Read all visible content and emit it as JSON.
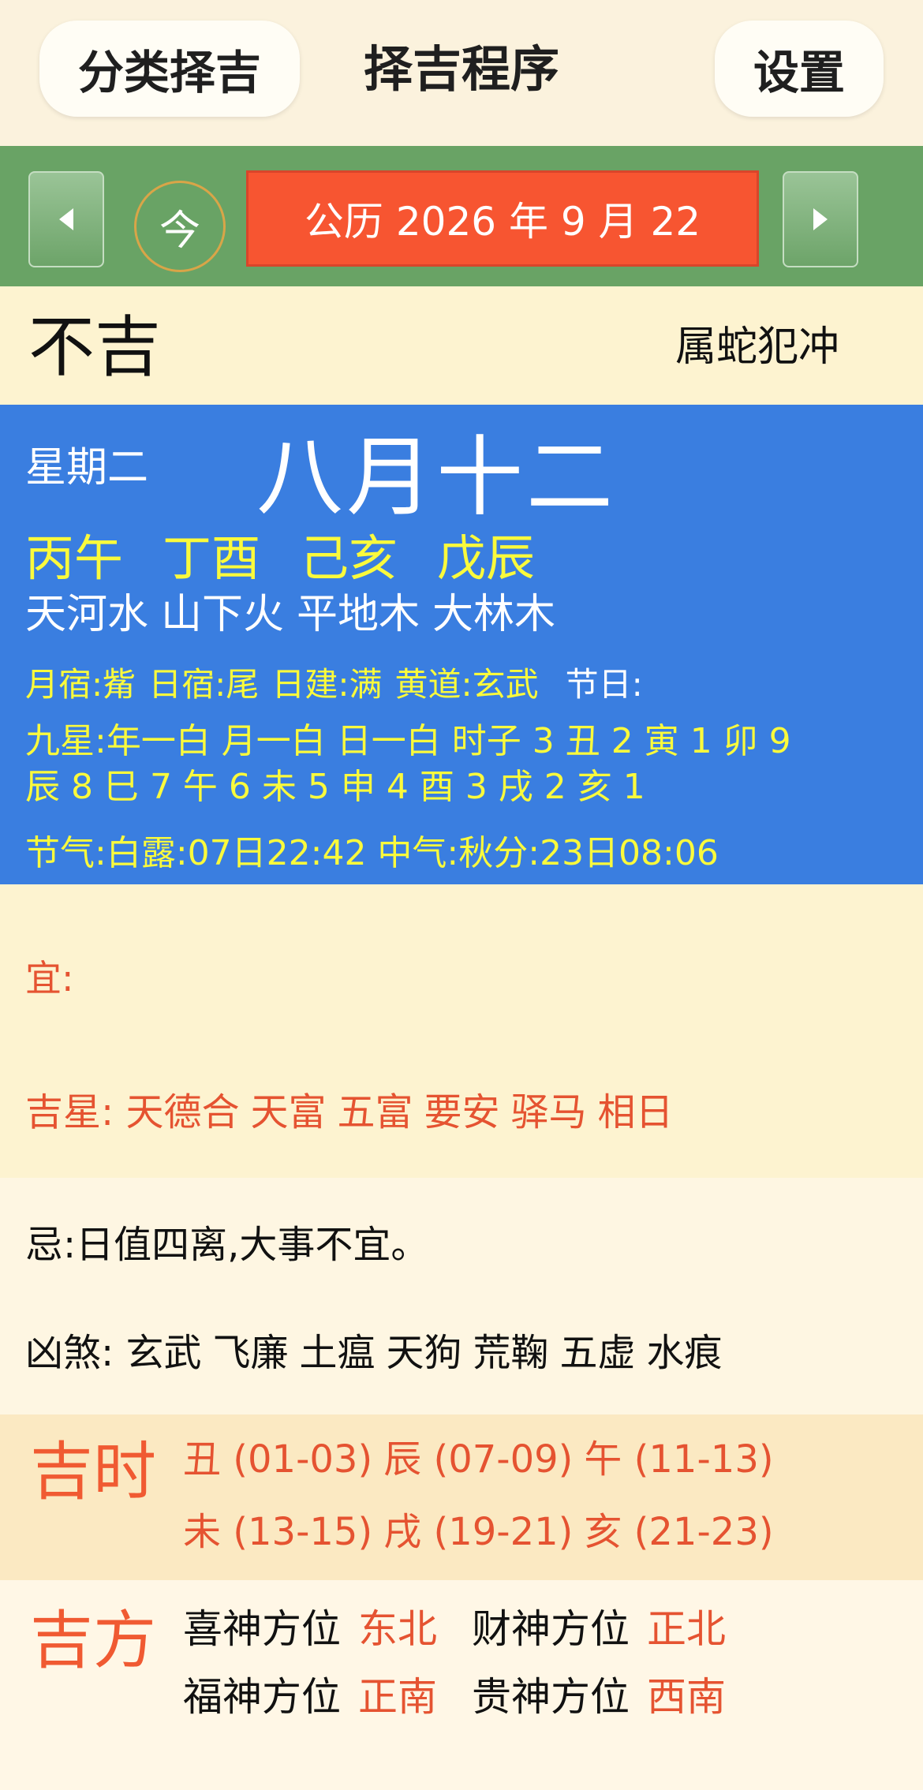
{
  "header": {
    "category_label": "分类择吉",
    "title": "择吉程序",
    "settings_label": "设置"
  },
  "date_nav": {
    "today_label": "今",
    "date_text": "公历 2026 年 9 月 22"
  },
  "verdict": {
    "text": "不吉",
    "clash": "属蛇犯冲"
  },
  "info": {
    "weekday": "星期二",
    "lunar_date": "八月十二",
    "ganzhi": [
      "丙午",
      "丁酉",
      "己亥",
      "戊辰"
    ],
    "nayin": [
      "天河水",
      "山下火",
      "平地木",
      "大林木"
    ],
    "month_xiu": "月宿:觜",
    "day_xiu": "日宿:尾",
    "day_jian": "日建:满",
    "huangdao": "黄道:玄武",
    "festival": "节日:",
    "nine_star_line1": "九星:年一白 月一白 日一白 时子 3 丑 2 寅 1 卯 9",
    "nine_star_line2": "辰 8 巳 7 午 6 未 5 申 4 酉 3 戌 2 亥 1",
    "solar_term": "节气:白露:07日22:42 中气:秋分:23日08:06"
  },
  "yi": {
    "label": "宜:",
    "jixing_label": "吉星:",
    "jixing": [
      "天德合",
      "天富",
      "五富",
      "要安",
      "驿马",
      "相日"
    ]
  },
  "ji": {
    "text": "忌:日值四离,大事不宜。",
    "xiongsha_label": "凶煞:",
    "xiongsha": [
      "玄武",
      "飞廉",
      "土瘟",
      "天狗",
      "荒鞠",
      "五虚",
      "水痕"
    ]
  },
  "lucky_hours": {
    "label": "吉时",
    "line1": [
      "丑 (01-03)",
      "辰 (07-09)",
      "午 (11-13)"
    ],
    "line2": [
      "未 (13-15)",
      "戌 (19-21)",
      "亥 (21-23)"
    ]
  },
  "lucky_directions": {
    "label": "吉方",
    "xishen_label": "喜神方位",
    "xishen_value": "东北",
    "caishen_label": "财神方位",
    "caishen_value": "正北",
    "fushen_label": "福神方位",
    "fushen_value": "正南",
    "guishen_label": "贵神方位",
    "guishen_value": "西南"
  },
  "colors": {
    "accent_red": "#f75531",
    "nav_green": "#69a365",
    "info_blue": "#3a7ee0",
    "highlight_yellow": "#fafa3c"
  }
}
